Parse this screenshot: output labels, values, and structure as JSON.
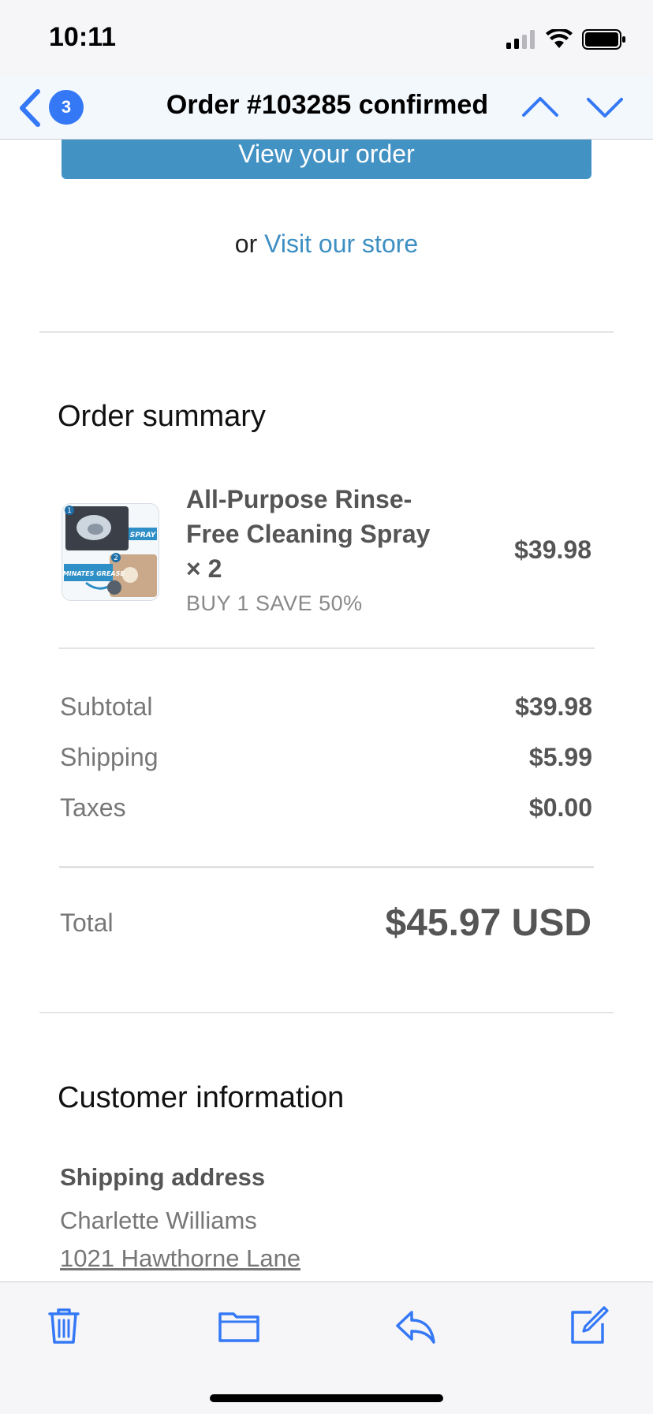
{
  "status_bar": {
    "time": "10:11",
    "icons": [
      "cellular-signal-icon",
      "wifi-icon",
      "battery-icon"
    ]
  },
  "nav": {
    "badge_count": "3",
    "title": "Order #103285 confirmed"
  },
  "actions": {
    "view_order_label": "View your order",
    "or_text": "or",
    "store_link": "Visit our store"
  },
  "order_summary": {
    "title": "Order summary",
    "item": {
      "name": "All-Purpose Rinse-Free Cleaning Spray × 2",
      "variant": "BUY 1 SAVE 50%",
      "price": "$39.98",
      "thumb_labels": {
        "step1": "1",
        "spray": "SPRAY",
        "step2": "2",
        "grease": "ELIMINATES GREASE"
      }
    },
    "rows": [
      {
        "label": "Subtotal",
        "value": "$39.98"
      },
      {
        "label": "Shipping",
        "value": "$5.99"
      },
      {
        "label": "Taxes",
        "value": "$0.00"
      }
    ],
    "total_label": "Total",
    "total_value": "$45.97 USD"
  },
  "customer": {
    "title": "Customer information",
    "shipping_heading": "Shipping address",
    "name": "Charlette Williams",
    "street": "1021 Hawthorne Lane"
  },
  "colors": {
    "accent": "#3478f6",
    "button": "#4392c4",
    "link": "#3d8fc3"
  }
}
